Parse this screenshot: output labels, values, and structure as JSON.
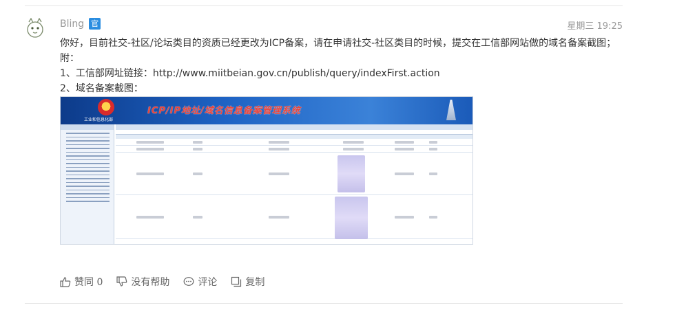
{
  "post": {
    "username": "Bling",
    "badge": "官",
    "timestamp": "星期三 19:25",
    "lines": [
      "你好，目前社交-社区/论坛类目的资质已经更改为ICP备案，请在申请社交-社区类目的时候，提交在工信部网站做的域名备案截图；",
      "附：",
      "1、工信部网址链接：http://www.miitbeian.gov.cn/publish/query/indexFirst.action",
      "2、域名备案截图："
    ]
  },
  "screenshot": {
    "title": "ICP/IP地址/域名信息备案管理系统",
    "org": "工业和信息化部"
  },
  "actions": {
    "like": "赞同 0",
    "unhelpful": "没有帮助",
    "comment": "评论",
    "copy": "复制"
  },
  "colors": {
    "badge": "#2a8de0",
    "banner": "#1e63c4",
    "title_red": "#e8453c"
  }
}
